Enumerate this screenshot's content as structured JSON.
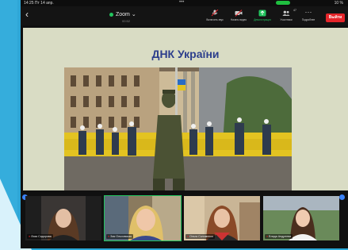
{
  "status_bar": {
    "time": "14:25 Пт 14 апр.",
    "right": "10 %"
  },
  "meeting": {
    "title": "Zoom",
    "subtitle": "00:52"
  },
  "toolbar": {
    "mic_label": "Включить звук",
    "video_label": "Начать видео",
    "share_label": "Демонстрация",
    "participants_label": "Участники",
    "participants_count": "47",
    "more_label": "Подробнее",
    "leave_label": "Выйти"
  },
  "slide": {
    "title": "ДНК України"
  },
  "participants": [
    {
      "name": "Лиза Сидорова"
    },
    {
      "name": "Зая Ольховская"
    },
    {
      "name": "Ольга Соломенко"
    },
    {
      "name": "Влада Андреева"
    }
  ],
  "colors": {
    "accent_green": "#22c55e",
    "leave_red": "#e5252a",
    "title_blue": "#2c3e8c"
  }
}
